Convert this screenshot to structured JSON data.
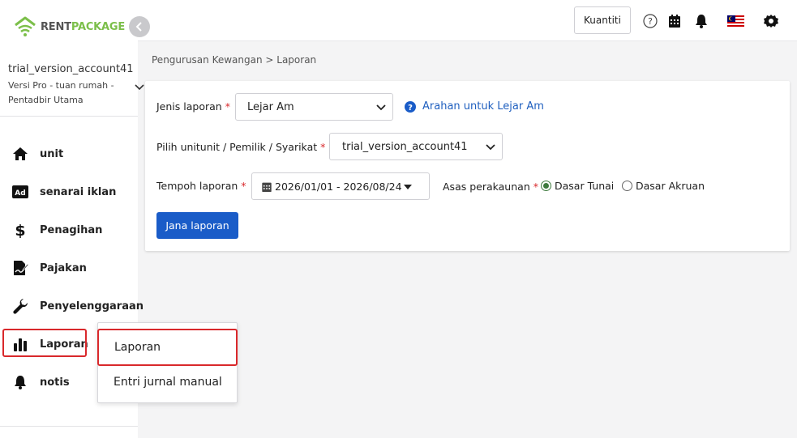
{
  "brand": {
    "part1": "RENT",
    "part2": "PACKAGE",
    "color_green": "#7cbf4a"
  },
  "account": {
    "name": "trial_version_account41",
    "role_line1": "Versi Pro - tuan rumah -",
    "role_line2": "Pentadbir Utama"
  },
  "nav": {
    "items": [
      {
        "label": "unit",
        "icon": "home-icon"
      },
      {
        "label": "senarai iklan",
        "icon": "ad-icon"
      },
      {
        "label": "Penagihan",
        "icon": "dollar-icon"
      },
      {
        "label": "Pajakan",
        "icon": "contract-icon"
      },
      {
        "label": "Penyelenggaraan",
        "icon": "wrench-icon"
      },
      {
        "label": "Laporan",
        "icon": "bar-chart-icon",
        "active": true
      },
      {
        "label": "notis",
        "icon": "bell-icon"
      }
    ]
  },
  "topbar": {
    "kuantiti_label": "Kuantiti",
    "icons": [
      "help-icon",
      "calendar-icon",
      "bell-icon",
      "malaysia-flag-icon",
      "gear-icon"
    ]
  },
  "breadcrumb": "Pengurusan Kewangan > Laporan",
  "form": {
    "report_type_label": "Jenis laporan",
    "report_type_value": "Lejar Am",
    "help_link": "Arahan untuk Lejar Am",
    "unit_label": "Pilih unitunit / Pemilik / Syarikat",
    "unit_value": "trial_version_account41",
    "period_label": "Tempoh laporan",
    "period_value": "2026/01/01 - 2026/08/24",
    "basis_label": "Asas perakaunan",
    "basis_options": [
      "Dasar Tunai",
      "Dasar Akruan"
    ],
    "basis_selected": "Dasar Tunai",
    "required_mark": "*",
    "submit_label": "Jana laporan"
  },
  "submenu": {
    "items": [
      "Laporan",
      "Entri jurnal manual"
    ],
    "active": "Laporan"
  },
  "colors": {
    "primary": "#1a5cc8",
    "highlight": "#d9282b",
    "link": "#1f5fbf"
  }
}
